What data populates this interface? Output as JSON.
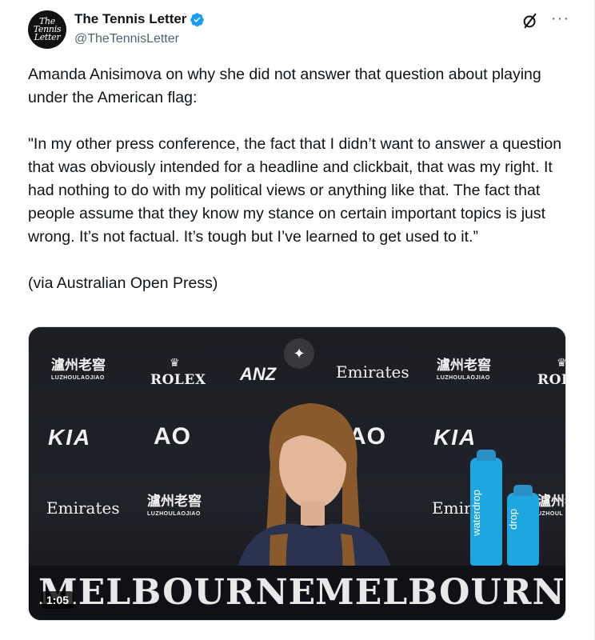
{
  "author": {
    "display_name": "The Tennis Letter",
    "handle": "@TheTennisLetter",
    "avatar_text": [
      "The",
      "Tennis",
      "Letter"
    ],
    "verified": true
  },
  "tweet": {
    "paragraphs": [
      "Amanda Anisimova on why she did not answer that question about playing under the American flag:",
      "\"In my other press conference, the fact that I didn’t want to answer a question that was obviously intended for a headline and clickbait, that was my right. It had nothing to do with my political views or anything like that. The fact that people assume that they know my stance on certain important topics is just wrong. It’s not factual. It’s tough but I’ve learned to get used to it.”",
      "(via Australian Open Press)"
    ]
  },
  "media": {
    "type": "video",
    "duration": "1:05",
    "sponsors": {
      "rolex": "ROLEX",
      "rolex_partial": "ROL",
      "emirates": "Emirates",
      "emirates_partial": "Emir",
      "ao": "AO",
      "kia": "KIA",
      "anz": "ANZ",
      "luzhou": "瀘州老窖",
      "luzhou_sub": "LUZHOULAOJIAO",
      "luzhou_sub_partial": "UZHOUL",
      "melbourne": "MELBOURNE",
      "melbourne_partial": "MELBOURNE",
      "bottle_label": "waterdrop",
      "bottle_label_partial": "drop"
    }
  },
  "icons": {
    "verified": "verified-badge-icon",
    "grok": "grok-icon",
    "more": "more-options-icon",
    "sparkle": "sparkle-icon"
  },
  "colors": {
    "verified_blue": "#1d9bf0",
    "handle_gray": "#536471",
    "bottle_blue": "#1ea6e0"
  }
}
